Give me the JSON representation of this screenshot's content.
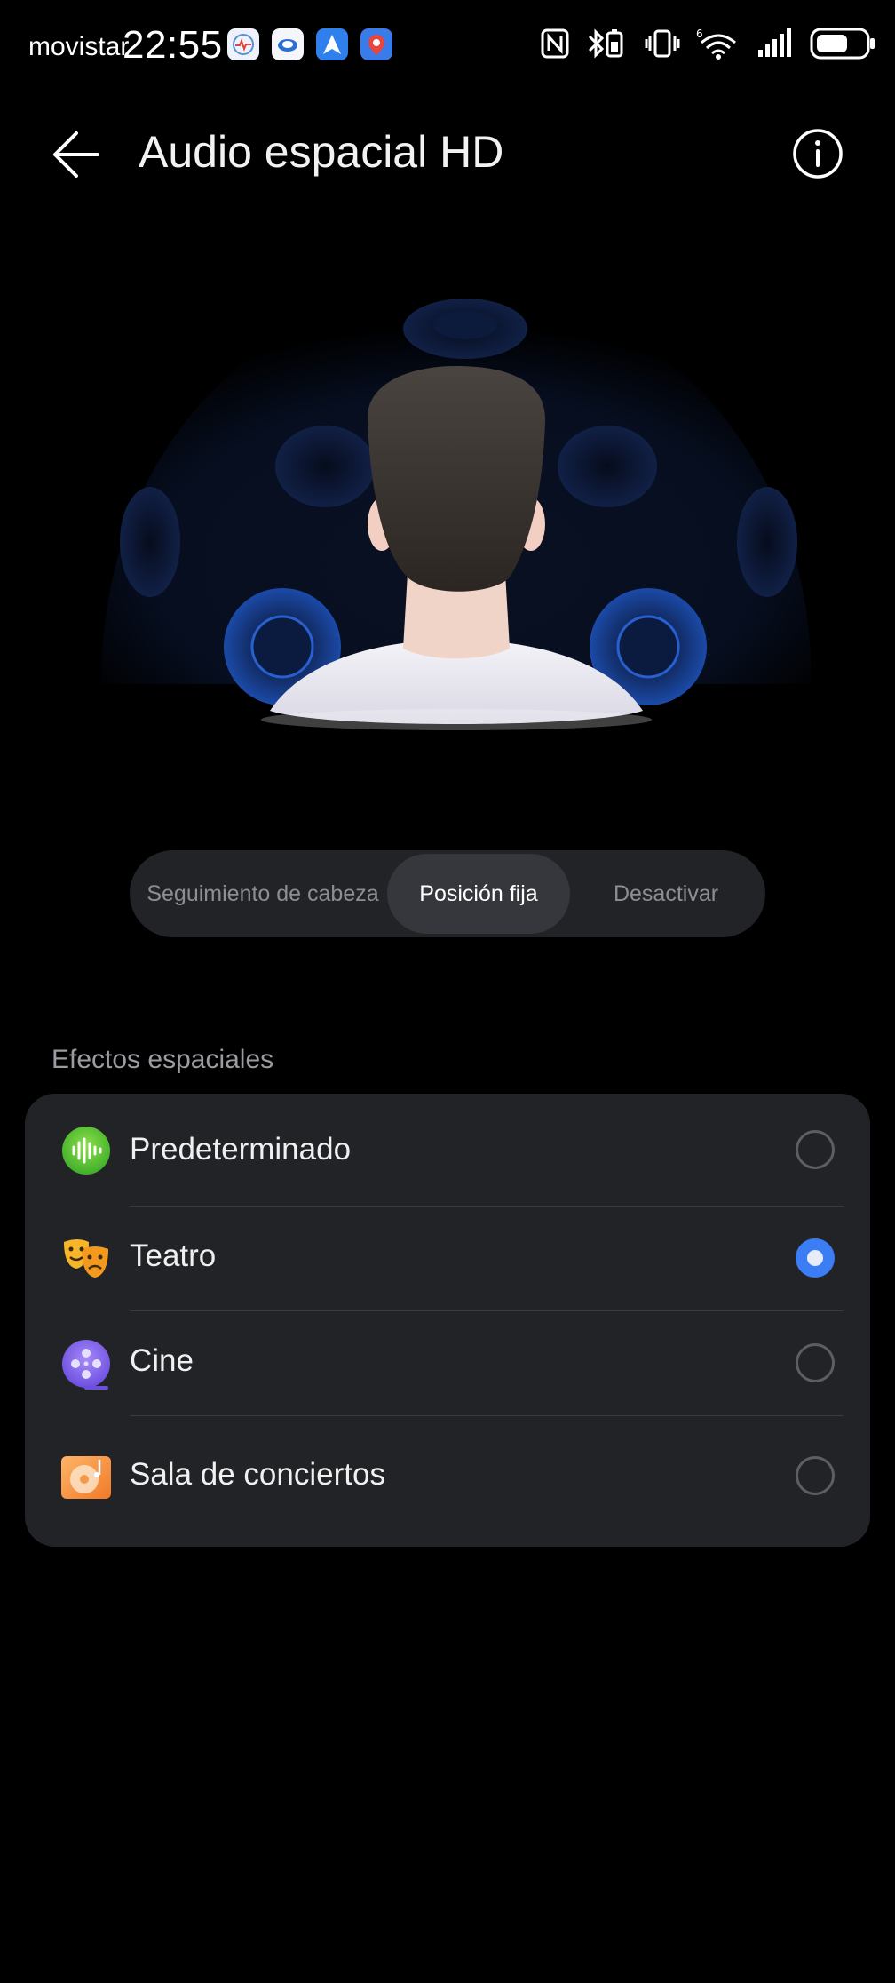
{
  "status_bar": {
    "carrier": "movistar",
    "time": "22:55",
    "notification_icons": [
      "heart-rate-app-icon",
      "cloud-app-icon",
      "paper-plane-app-icon",
      "maps-pin-app-icon"
    ],
    "system_icons": [
      "nfc-icon",
      "bluetooth-battery-icon",
      "vibrate-icon",
      "wifi-6-icon",
      "signal-icon",
      "battery-icon"
    ]
  },
  "header": {
    "title": "Audio espacial HD",
    "back_icon": "arrow-left-icon",
    "info_icon": "info-icon"
  },
  "mode_selector": {
    "options": [
      "Seguimiento de cabeza",
      "Posición fija",
      "Desactivar"
    ],
    "selected": "Posición fija"
  },
  "effects": {
    "section_label": "Efectos espaciales",
    "items": [
      {
        "label": "Predeterminado",
        "icon": "soundwave-icon",
        "selected": false
      },
      {
        "label": "Teatro",
        "icon": "theater-masks-icon",
        "selected": true
      },
      {
        "label": "Cine",
        "icon": "film-reel-icon",
        "selected": false
      },
      {
        "label": "Sala de conciertos",
        "icon": "music-disc-icon",
        "selected": false
      }
    ]
  },
  "colors": {
    "background": "#000000",
    "card": "#222327",
    "accent": "#3a7df5"
  }
}
